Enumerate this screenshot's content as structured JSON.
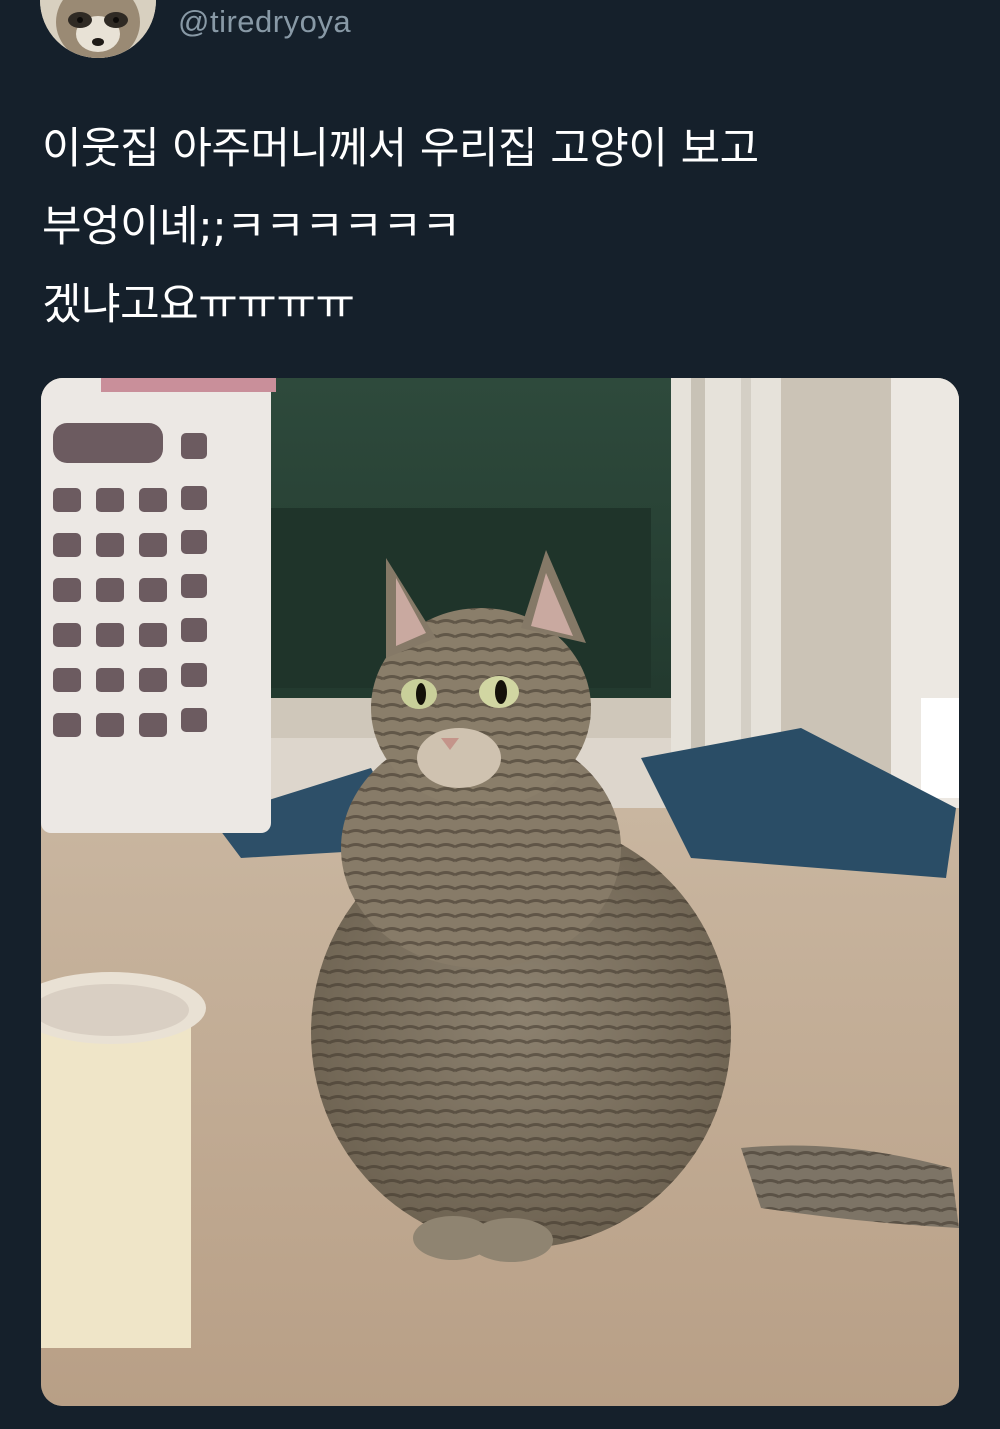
{
  "tweet": {
    "avatar_icon": "raccoon-avatar",
    "handle": "@tiredryoya",
    "text_lines": [
      "이웃집 아주머니께서 우리집 고양이 보고",
      "부엉이녜;;ㅋㅋㅋㅋㅋㅋ",
      "겠냐고요ㅠㅠㅠㅠ"
    ],
    "media": {
      "subject": "tabby cat sitting on floor"
    }
  },
  "colors": {
    "background": "#15202b",
    "text": "#ffffff",
    "handle": "#8899a6"
  }
}
